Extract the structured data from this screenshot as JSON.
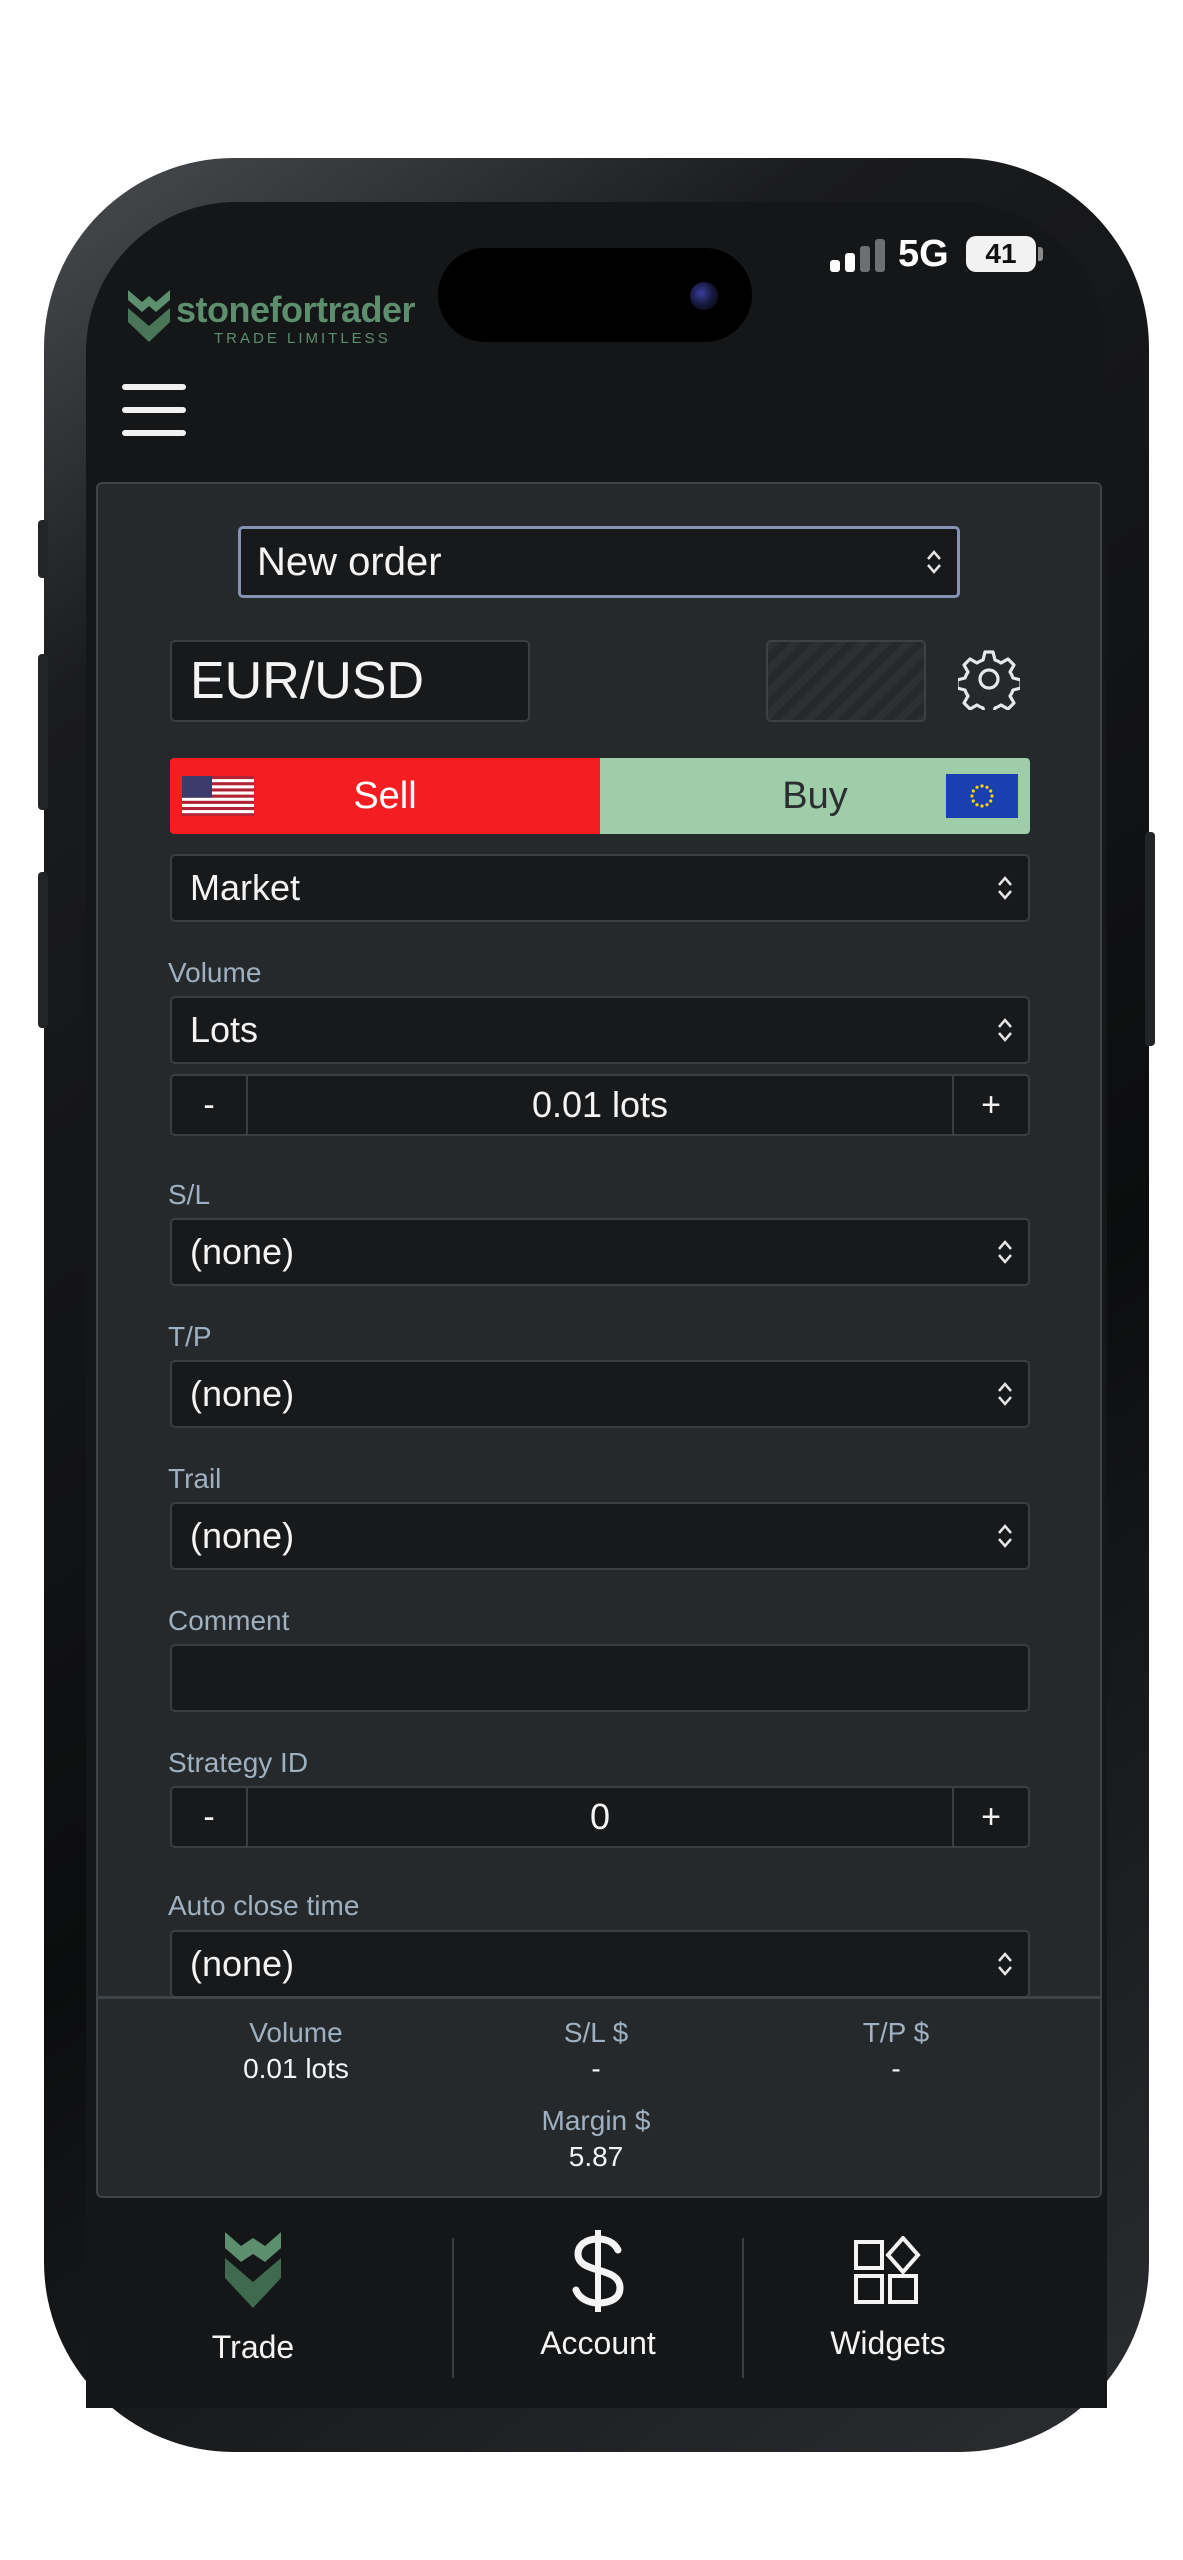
{
  "status_bar": {
    "network": "5G",
    "battery": "41"
  },
  "brand": {
    "name": "stonefortrader",
    "tagline": "TRADE LIMITLESS"
  },
  "order": {
    "mode": "New order",
    "symbol": "EUR/USD",
    "sell_label": "Sell",
    "buy_label": "Buy",
    "order_type": "Market"
  },
  "form": {
    "volume_label": "Volume",
    "volume_unit": "Lots",
    "volume_value": "0.01 lots",
    "minus": "-",
    "plus": "+",
    "sl_label": "S/L",
    "sl_value": "(none)",
    "tp_label": "T/P",
    "tp_value": "(none)",
    "trail_label": "Trail",
    "trail_value": "(none)",
    "comment_label": "Comment",
    "comment_value": "",
    "strategy_label": "Strategy ID",
    "strategy_value": "0",
    "autoclose_label": "Auto close time",
    "autoclose_value": "(none)"
  },
  "summary": {
    "volume_label": "Volume",
    "volume_value": "0.01 lots",
    "sl_label": "S/L $",
    "sl_value": "-",
    "tp_label": "T/P $",
    "tp_value": "-",
    "margin_label": "Margin $",
    "margin_value": "5.87"
  },
  "tabs": [
    {
      "label": "Trade",
      "icon": "brand-shield-icon"
    },
    {
      "label": "Account",
      "icon": "dollar-icon"
    },
    {
      "label": "Widgets",
      "icon": "widgets-icon"
    }
  ],
  "colors": {
    "sell": "#f41d22",
    "buy": "#9fcca9",
    "brand": "#5d8f6e",
    "panel": "#25292c"
  }
}
